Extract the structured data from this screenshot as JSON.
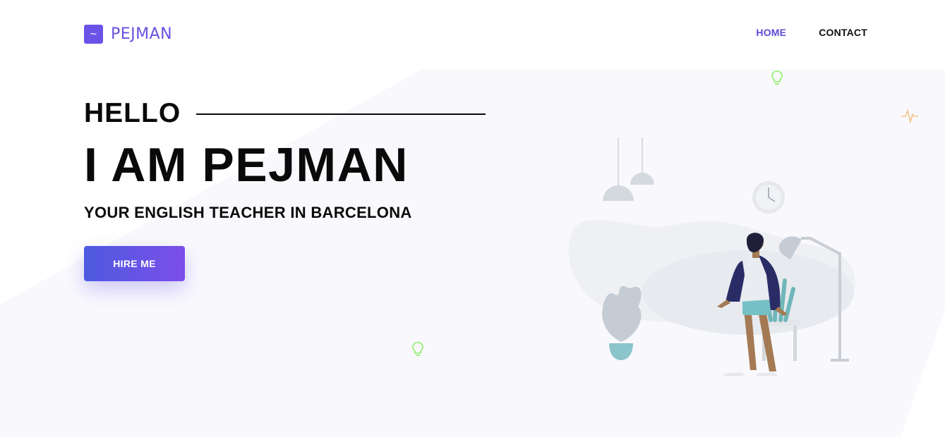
{
  "brand": {
    "logo_glyph": "~",
    "name": "PEJMAN",
    "color": "#6c53e8"
  },
  "nav": {
    "items": [
      {
        "label": "HOME",
        "active": true
      },
      {
        "label": "CONTACT",
        "active": false
      }
    ],
    "active_color": "#5b4bd8"
  },
  "hero": {
    "greeting": "HELLO",
    "headline": "I AM PEJMAN",
    "tagline": "YOUR ENGLISH TEACHER IN BARCELONA",
    "cta_label": "HIRE ME"
  },
  "colors": {
    "button_gradient_start": "#4e5ae0",
    "button_gradient_end": "#7b4fe9",
    "background_panel": "#f9f9fd",
    "bulb_icon": "#9af07a",
    "pulse_icon": "#f4c28a"
  },
  "icons": [
    "logo-icon",
    "lightbulb-icon",
    "pulse-icon",
    "wall-clock-icon"
  ]
}
